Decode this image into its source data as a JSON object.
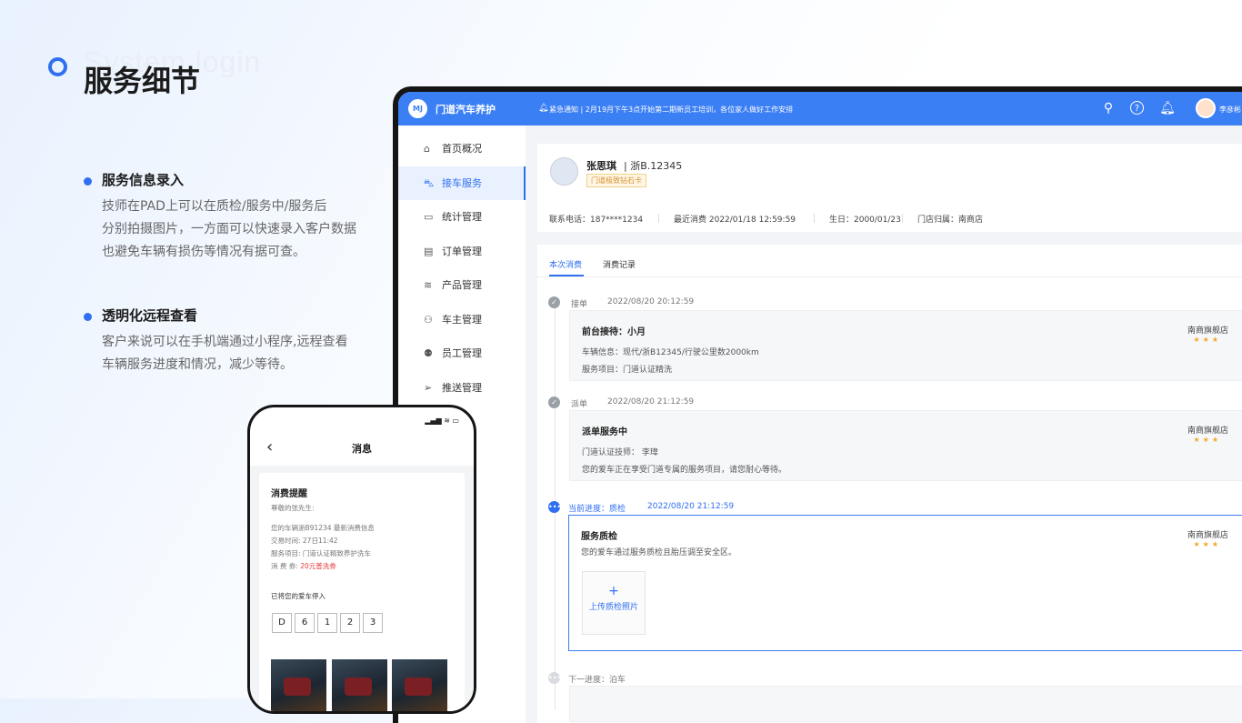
{
  "page": {
    "ghost_title": "System login",
    "title": "服务细节",
    "features": [
      {
        "title": "服务信息录入",
        "desc": [
          "技师在PAD上可以在质检/服务中/服务后",
          "分别拍摄图片，一方面可以快速录入客户数据",
          "也避免车辆有损伤等情况有据可查。"
        ]
      },
      {
        "title": "透明化远程查看",
        "desc": [
          "客户来说可以在手机端通过小程序,远程查看",
          "车辆服务进度和情况，减少等待。"
        ]
      }
    ]
  },
  "app": {
    "logo": "MJ",
    "name": "门道汽车养护",
    "notice": "紧急通知 | 2月19月下午3点开始第二期新员工培训，各位家人做好工作安排",
    "user": "李彦彬",
    "icons": [
      "search-icon",
      "help-icon",
      "bell-icon",
      "avatar"
    ],
    "menu": [
      {
        "icon": "home-icon",
        "label": "首页概况"
      },
      {
        "icon": "car-icon",
        "label": "接车服务"
      },
      {
        "icon": "chart-icon",
        "label": "统计管理"
      },
      {
        "icon": "doc-icon",
        "label": "订单管理"
      },
      {
        "icon": "layers-icon",
        "label": "产品管理"
      },
      {
        "icon": "user-icon",
        "label": "车主管理"
      },
      {
        "icon": "users-icon",
        "label": "员工管理"
      },
      {
        "icon": "send-icon",
        "label": "推送管理"
      }
    ],
    "active_menu": "接车服务",
    "customer": {
      "name": "张思琪",
      "plate": "| 浙B.12345",
      "badge": "门道极致钻石卡",
      "phone": "联系电话：187****1234",
      "last": "最近消费  2022/01/18   12:59:59",
      "birthday": "生日：2000/01/23",
      "store": "门店归属：南商店"
    },
    "tabs": [
      "本次消费",
      "消费记录"
    ],
    "timeline": [
      {
        "label": "接单",
        "time": "2022/08/20  20:12:59",
        "title": "前台接待：小月",
        "lines": [
          "车辆信息：现代/浙B12345/行驶公里数2000km",
          "服务项目：门道认证精洗"
        ],
        "store": "南商旗舰店",
        "stars": "★★★"
      },
      {
        "label": "派单",
        "time": "2022/08/20  21:12:59",
        "title": "派单服务中",
        "lines": [
          "门道认证技师：  李瑋",
          "您的爱车正在享受门道专属的服务项目，请您耐心等待。"
        ],
        "store": "南商旗舰店",
        "stars": "★★★"
      },
      {
        "label": "当前进度：质检",
        "time": "2022/08/20  21:12:59",
        "title": "服务质检",
        "lines": [
          "您的爱车通过服务质检且胎压调至安全区。"
        ],
        "store": "南商旗舰店",
        "stars": "★★★",
        "upload_plus": "+",
        "upload_label": "上传质检照片"
      },
      {
        "label": "下一进度：泊车"
      }
    ]
  },
  "phone": {
    "status": "▂▄▆  ≋  ▭",
    "back": "‹",
    "title": "消息",
    "msg_title": "消费提醒",
    "greeting": "尊敬的张先生:",
    "line1": "您的车辆浙B91234 最新消费信息",
    "line2": "交易时间:   27日11:42",
    "line3": "服务项目:   门道认证精致养护洗车",
    "line4_label": "消  费  券:",
    "line4_value": "20元普洗券",
    "parked": "已将您的爱车停入",
    "plates": [
      "D",
      "6",
      "1",
      "2",
      "3"
    ]
  },
  "colors": {
    "accent": "#2f6ff0",
    "topbar": "#3b7ff5",
    "star": "#f5a623"
  }
}
